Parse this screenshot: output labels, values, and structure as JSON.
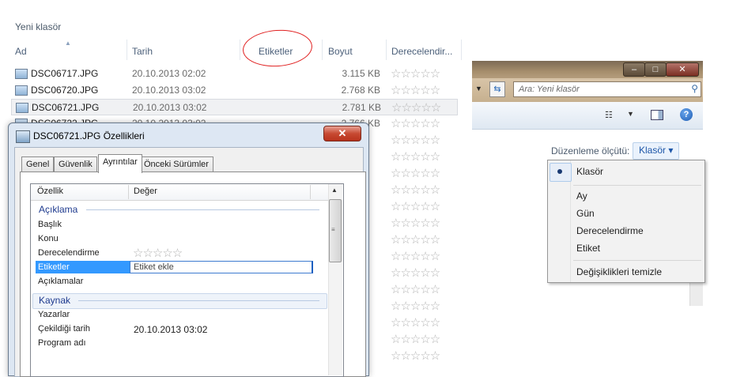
{
  "explorer": {
    "folder_title": "Yeni klasör",
    "columns": [
      "Ad",
      "Tarih",
      "Etiketler",
      "Boyut",
      "Derecelendir..."
    ],
    "files": [
      {
        "name": "DSC06717.JPG",
        "date": "20.10.2013 02:02",
        "size": "3.115 KB"
      },
      {
        "name": "DSC06720.JPG",
        "date": "20.10.2013 03:02",
        "size": "2.768 KB"
      },
      {
        "name": "DSC06721.JPG",
        "date": "20.10.2013 03:02",
        "size": "2.781 KB",
        "selected": true
      },
      {
        "name": "DSC06722.JPG",
        "date": "20.10.2013 03:02",
        "size": "2.766 KB"
      }
    ],
    "rating_stars": "☆☆☆☆☆"
  },
  "right_window": {
    "search_placeholder": "Ara: Yeni klasör",
    "buttons": {
      "minimize": "–",
      "maximize": "□",
      "close": "✕"
    },
    "arrange_label": "Düzenleme ölçütü:",
    "arrange_value": "Klasör ▾",
    "help": "?"
  },
  "arrange_menu": {
    "items": [
      "Klasör",
      "Ay",
      "Gün",
      "Derecelendirme",
      "Etiket",
      "Değişiklikleri temizle"
    ],
    "selected": "Klasör"
  },
  "dialog": {
    "title": "DSC06721.JPG Özellikleri",
    "close": "✕",
    "tabs": [
      "Genel",
      "Güvenlik",
      "Ayrıntılar",
      "Önceki Sürümler"
    ],
    "active_tab": "Ayrıntılar",
    "columns": {
      "property": "Özellik",
      "value": "Değer"
    },
    "groups": [
      {
        "name": "Açıklama",
        "rows": [
          {
            "label": "Başlık",
            "value": ""
          },
          {
            "label": "Konu",
            "value": ""
          },
          {
            "label": "Derecelendirme",
            "value": "☆☆☆☆☆"
          },
          {
            "label": "Etiketler",
            "value": "Etiket ekle"
          },
          {
            "label": "Açıklamalar",
            "value": ""
          }
        ]
      },
      {
        "name": "Kaynak",
        "rows": [
          {
            "label": "Yazarlar",
            "value": ""
          },
          {
            "label": "Çekildiği tarih",
            "value": "20.10.2013 03:02"
          },
          {
            "label": "Program adı",
            "value": ""
          }
        ]
      }
    ]
  },
  "colors": {
    "annotation_circle": "#e02020",
    "selection": "#3399ff",
    "group_header": "#1e3a8e"
  }
}
